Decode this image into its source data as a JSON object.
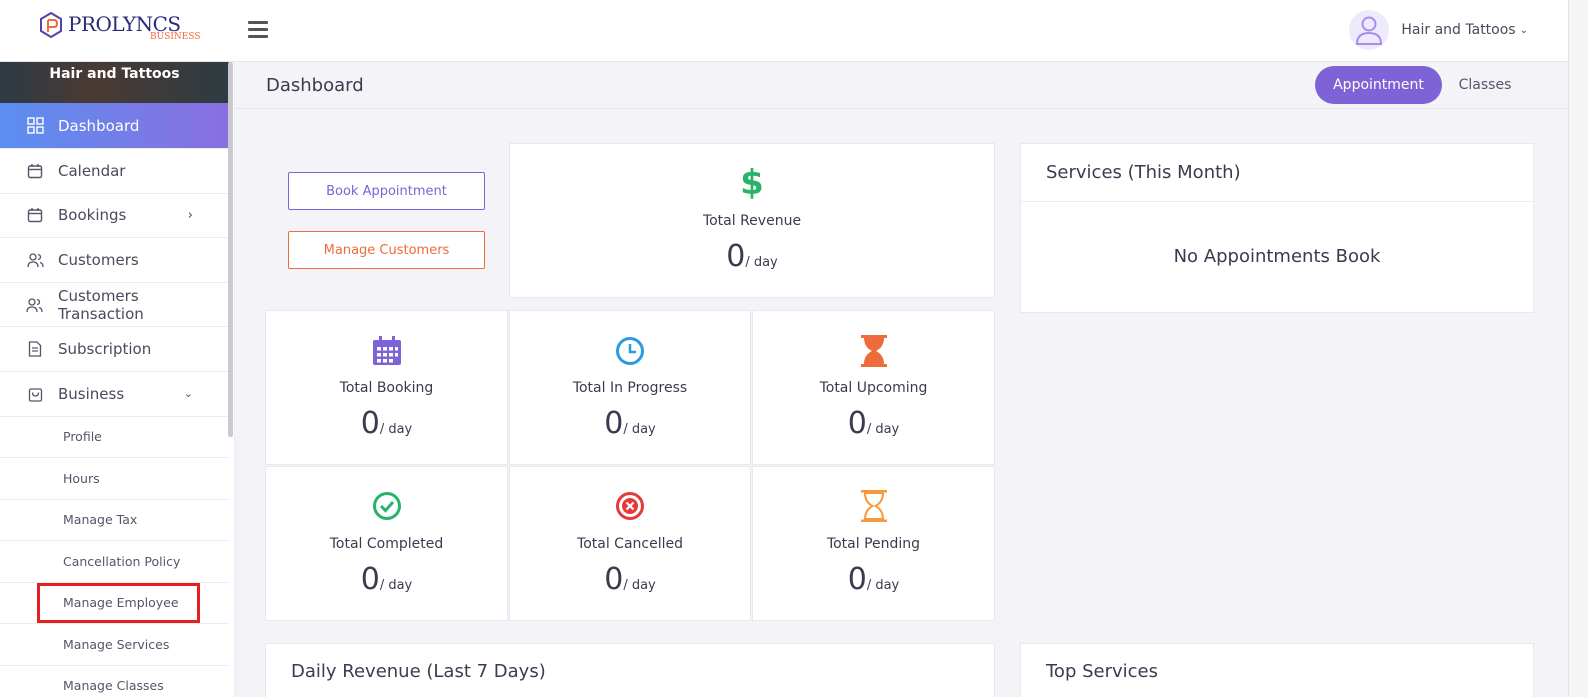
{
  "header": {
    "brand": "PROLYNCS",
    "brand_sub": "BUSINESS",
    "user_name": "Hair and Tattoos"
  },
  "sidebar": {
    "business_name": "Hair and Tattoos",
    "items": [
      {
        "label": "Dashboard"
      },
      {
        "label": "Calendar"
      },
      {
        "label": "Bookings"
      },
      {
        "label": "Customers"
      },
      {
        "label": "Customers Transaction"
      },
      {
        "label": "Subscription"
      },
      {
        "label": "Business"
      }
    ],
    "business_sub_items": [
      {
        "label": "Profile"
      },
      {
        "label": "Hours"
      },
      {
        "label": "Manage Tax"
      },
      {
        "label": "Cancellation Policy"
      },
      {
        "label": "Manage Employee"
      },
      {
        "label": "Manage Services"
      },
      {
        "label": "Manage Classes"
      }
    ]
  },
  "main": {
    "title": "Dashboard",
    "toggle": {
      "appointment": "Appointment",
      "classes": "Classes"
    },
    "actions": {
      "book": "Book Appointment",
      "customers": "Manage Customers"
    },
    "unit": "/ day",
    "revenue": {
      "label": "Total Revenue",
      "value": "0"
    },
    "stats": [
      {
        "label": "Total Booking",
        "value": "0",
        "icon": "calendar-grid-icon",
        "color": "#7d63d6"
      },
      {
        "label": "Total In Progress",
        "value": "0",
        "icon": "clock-icon",
        "color": "#2a9be0"
      },
      {
        "label": "Total Upcoming",
        "value": "0",
        "icon": "hourglass-filled-icon",
        "color": "#ee6b3b"
      },
      {
        "label": "Total Completed",
        "value": "0",
        "icon": "check-circle-icon",
        "color": "#27b36a"
      },
      {
        "label": "Total Cancelled",
        "value": "0",
        "icon": "x-circle-icon",
        "color": "#e53a3a"
      },
      {
        "label": "Total Pending",
        "value": "0",
        "icon": "hourglass-outline-icon",
        "color": "#f59a3a"
      }
    ],
    "services_panel": {
      "title": "Services (This Month)",
      "empty": "No Appointments Book"
    },
    "daily_revenue_title": "Daily Revenue (Last 7 Days)",
    "top_services_title": "Top Services"
  },
  "colors": {
    "accent": "#7d63d6",
    "orange": "#ee6b3b",
    "revenue_green": "#27b36a"
  }
}
